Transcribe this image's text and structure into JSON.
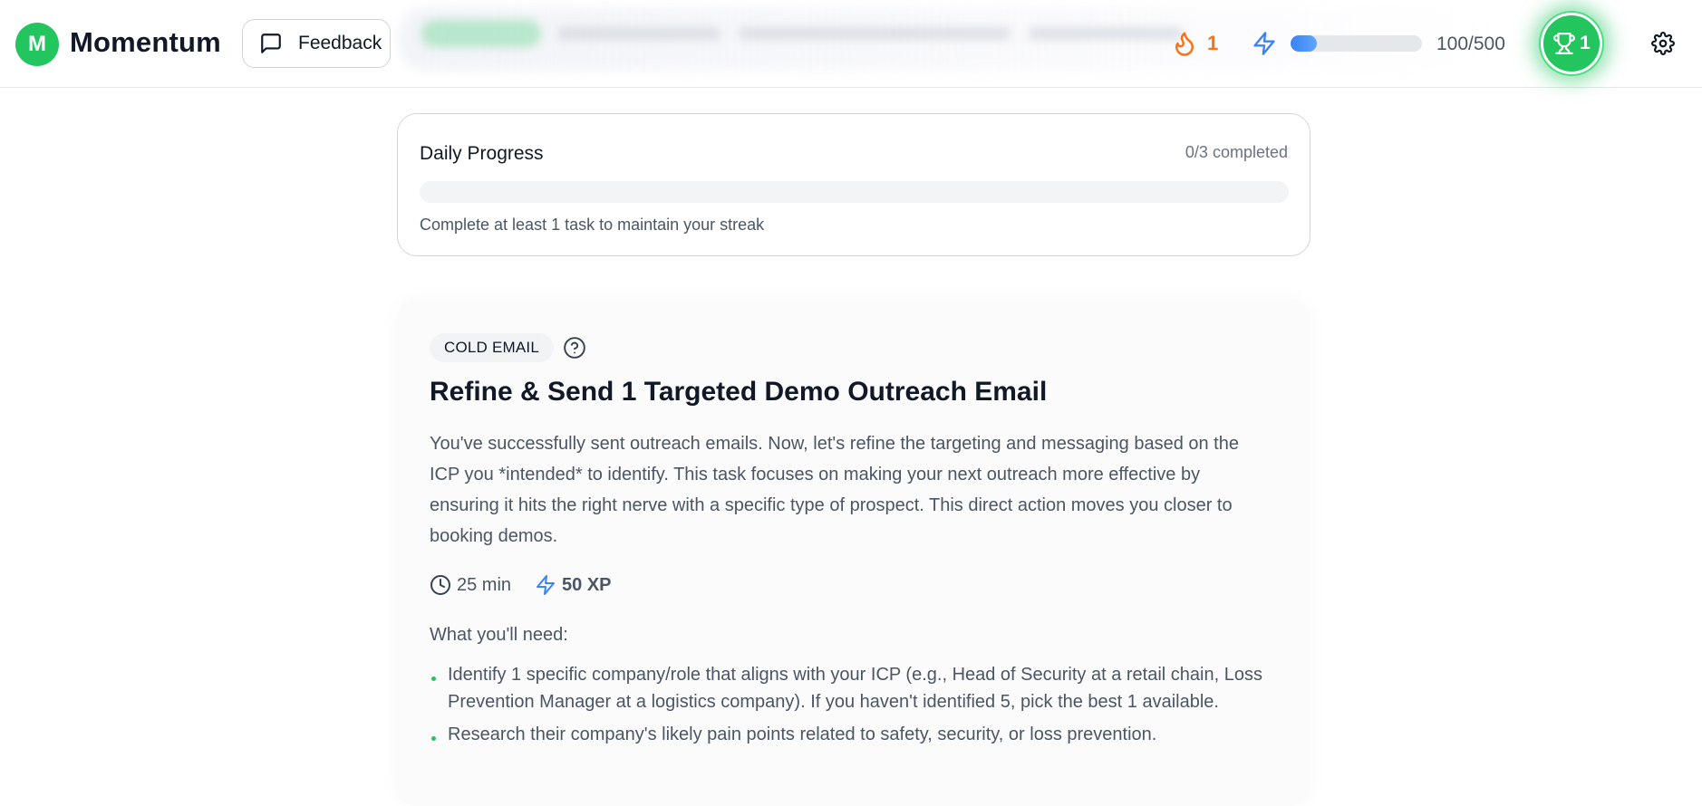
{
  "header": {
    "logo_letter": "M",
    "app_name": "Momentum",
    "feedback_label": "Feedback",
    "streak_count": "1",
    "xp_text": "100/500",
    "xp_progress": 0.2,
    "trophy_count": "1",
    "icons": [
      "chat-icon",
      "flame-icon",
      "lightning-icon",
      "trophy-icon",
      "gear-icon"
    ]
  },
  "daily_progress": {
    "title": "Daily Progress",
    "count_text": "0/3 completed",
    "progress": 0,
    "hint": "Complete at least 1 task to maintain your streak"
  },
  "task": {
    "category": "COLD EMAIL",
    "title": "Refine & Send 1 Targeted Demo Outreach Email",
    "description": "You've successfully sent outreach emails. Now, let's refine the targeting and messaging based on the ICP you *intended* to identify. This task focuses on making your next outreach more effective by ensuring it hits the right nerve with a specific type of prospect. This direct action moves you closer to booking demos.",
    "duration": "25 min",
    "xp": "50 XP",
    "needs_label": "What you'll need:",
    "needs": [
      "Identify 1 specific company/role that aligns with your ICP (e.g., Head of Security at a retail chain, Loss Prevention Manager at a logistics company). If you haven't identified 5, pick the best 1 available.",
      "Research their company's likely pain points related to safety, security, or loss prevention."
    ]
  },
  "colors": {
    "accent_green": "#22c55e",
    "streak_orange": "#f97316",
    "xp_blue": "#3b82f6"
  }
}
